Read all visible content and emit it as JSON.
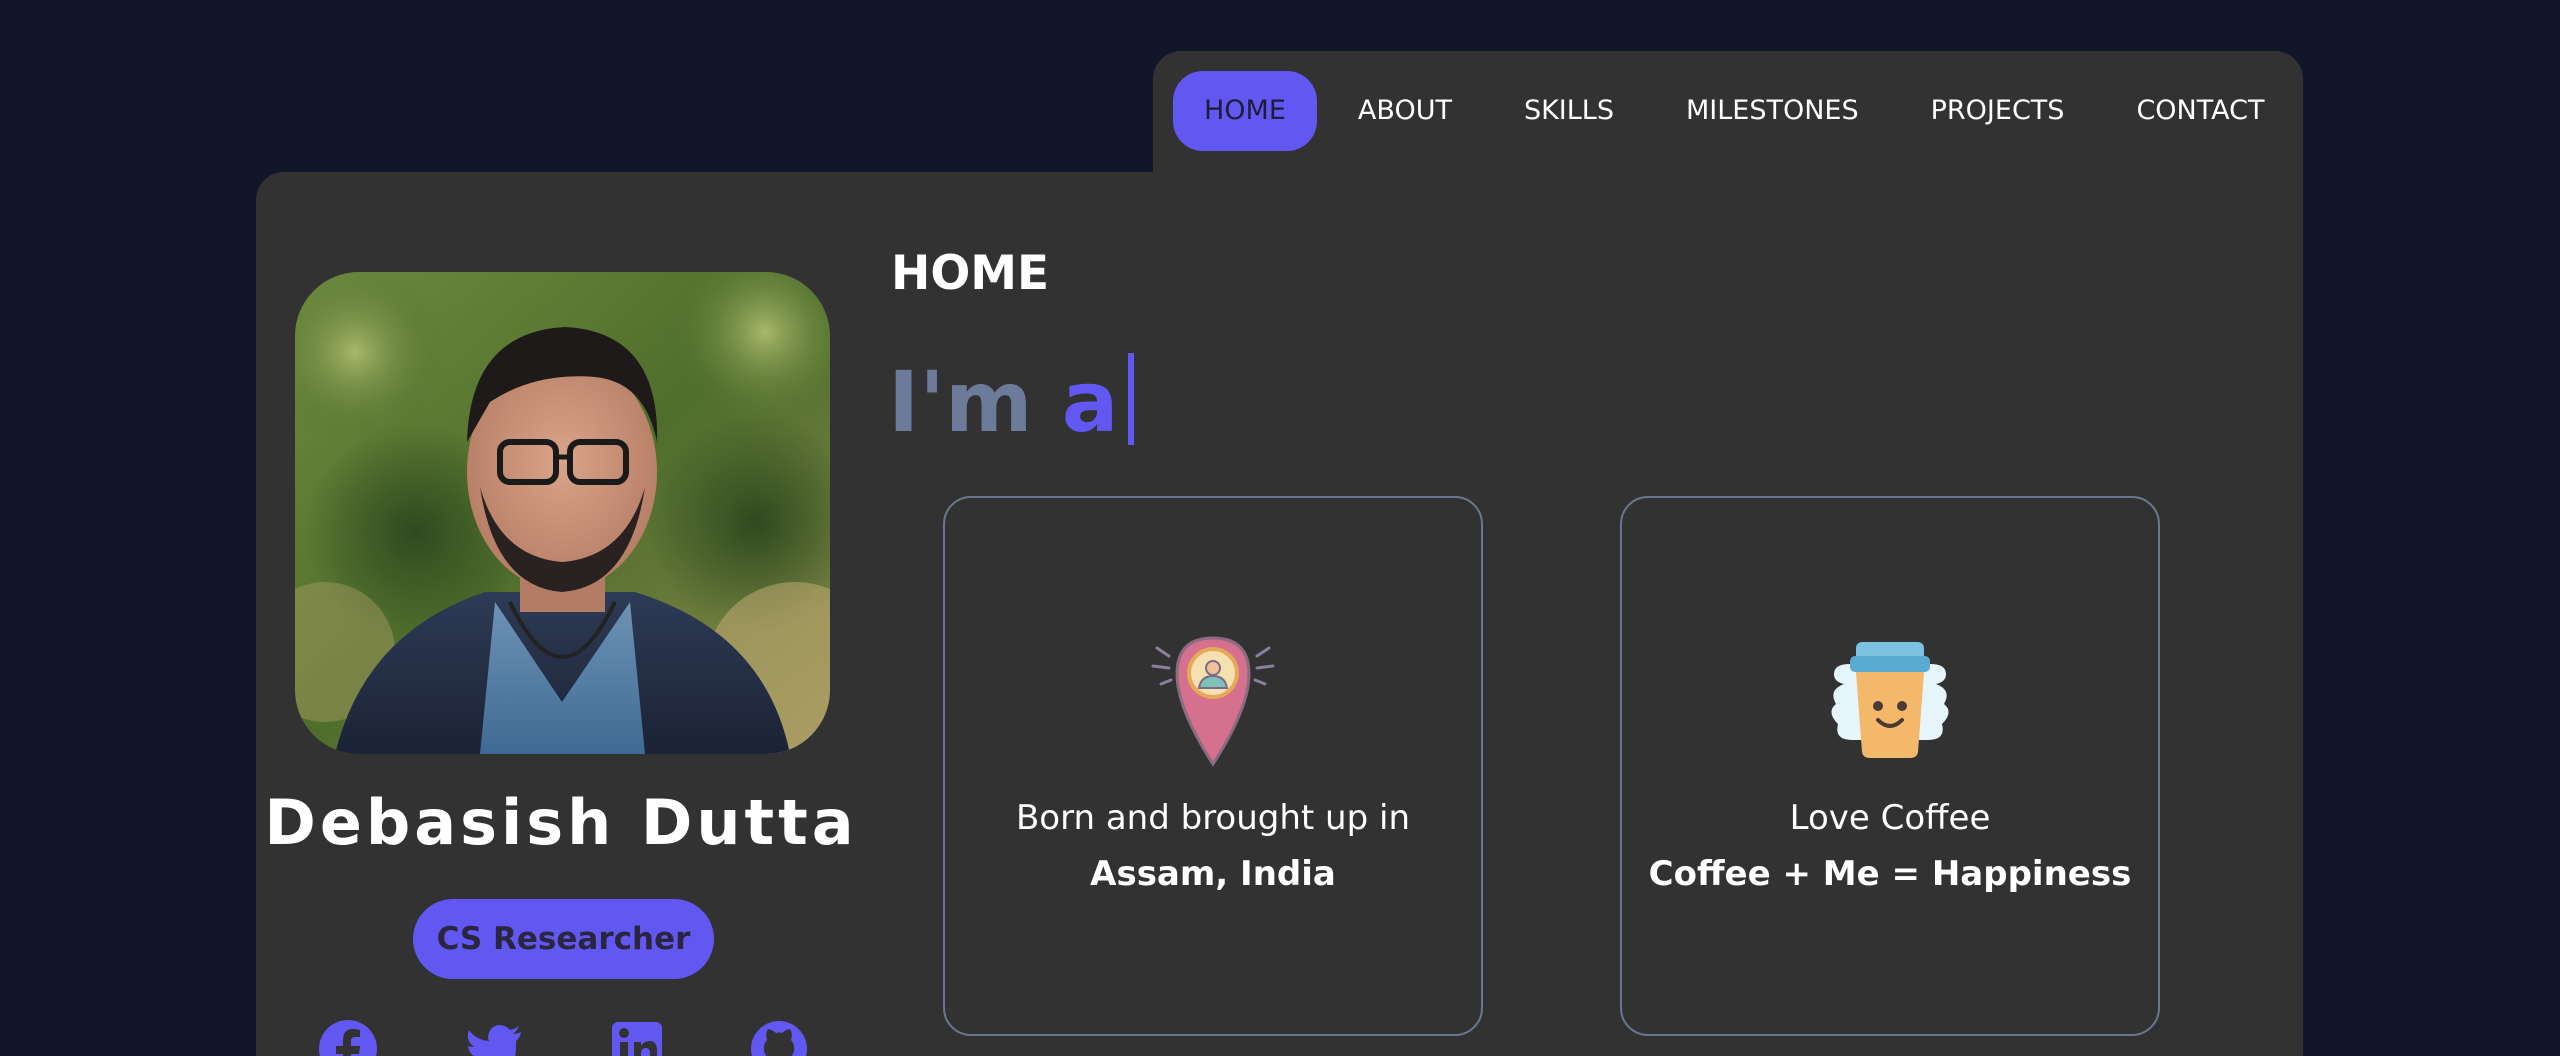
{
  "nav": {
    "items": [
      {
        "label": "HOME",
        "active": true
      },
      {
        "label": "ABOUT",
        "active": false
      },
      {
        "label": "SKILLS",
        "active": false
      },
      {
        "label": "MILESTONES",
        "active": false
      },
      {
        "label": "PROJECTS",
        "active": false
      },
      {
        "label": "CONTACT",
        "active": false
      }
    ]
  },
  "profile": {
    "name": "Debasish Dutta",
    "role": "CS Researcher",
    "socials": [
      "facebook-icon",
      "twitter-icon",
      "linkedin-icon",
      "github-icon"
    ]
  },
  "main": {
    "section_title": "HOME",
    "typer_prefix": "I'm",
    "typer_word": "a",
    "cards": [
      {
        "icon": "location-pin-icon",
        "line1": "Born and brought up in",
        "line2": "Assam, India"
      },
      {
        "icon": "coffee-cup-icon",
        "line1": "Love Coffee",
        "line2": "Coffee + Me = Happiness"
      }
    ]
  },
  "colors": {
    "background": "#11162a",
    "panel": "#323232",
    "accent": "#6258f1",
    "muted_text": "#6b7b99",
    "card_border": "#6b7792"
  }
}
